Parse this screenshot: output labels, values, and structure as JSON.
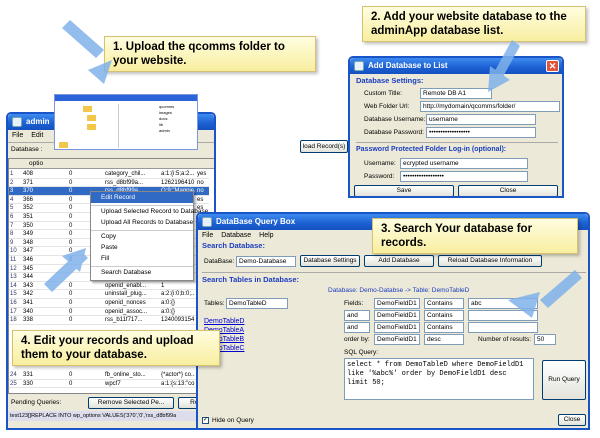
{
  "callouts": {
    "c1": "1. Upload the qcomms folder to your website.",
    "c2": "2. Add your website database to the adminApp database list.",
    "c3": "3. Search Your database for records.",
    "c4": "4. Edit your records and upload them to your database."
  },
  "admin": {
    "title": "admin",
    "menu": [
      "File",
      "Edit"
    ],
    "db_label": "Database :",
    "upload_btn": "load Record(s)",
    "col_header": "optio",
    "rows": [
      {
        "n": "1",
        "id": "408",
        "a": "0",
        "b": "category_chil...",
        "c": "a:1:{i:5;a:2...",
        "d": "yes"
      },
      {
        "n": "2",
        "id": "371",
        "a": "0",
        "b": "rss_d8bf99a...",
        "c": "1262196410",
        "d": "no"
      },
      {
        "n": "3",
        "id": "370",
        "a": "0",
        "b": "rss_d8bf99a...",
        "c": "O:9:\"Magpie...",
        "d": "no"
      },
      {
        "n": "4",
        "id": "366",
        "a": "0",
        "b": "",
        "c": "",
        "d": "es"
      },
      {
        "n": "5",
        "id": "352",
        "a": "0",
        "b": "",
        "c": "",
        "d": "es"
      },
      {
        "n": "6",
        "id": "351",
        "a": "0",
        "b": "",
        "c": "",
        "d": "es"
      },
      {
        "n": "7",
        "id": "350",
        "a": "0",
        "b": "",
        "c": "",
        "d": "es"
      },
      {
        "n": "8",
        "id": "349",
        "a": "0",
        "b": "",
        "c": "",
        "d": "es"
      },
      {
        "n": "9",
        "id": "348",
        "a": "0",
        "b": "",
        "c": "",
        "d": "es"
      },
      {
        "n": "10",
        "id": "347",
        "a": "0",
        "b": "",
        "c": "",
        "d": ""
      },
      {
        "n": "11",
        "id": "346",
        "a": "0",
        "b": "",
        "c": "",
        "d": ""
      },
      {
        "n": "12",
        "id": "345",
        "a": "",
        "b": "",
        "c": "",
        "d": ""
      },
      {
        "n": "13",
        "id": "344",
        "a": "",
        "b": "",
        "c": "",
        "d": ""
      },
      {
        "n": "14",
        "id": "343",
        "a": "0",
        "b": "openid_enabl...",
        "c": "1",
        "d": ""
      },
      {
        "n": "15",
        "id": "342",
        "a": "0",
        "b": "uninstall_plug...",
        "c": "a:2:{i:0;b:0;...",
        "d": ""
      },
      {
        "n": "16",
        "id": "341",
        "a": "0",
        "b": "openid_nonces",
        "c": "a:0:{}",
        "d": ""
      },
      {
        "n": "17",
        "id": "340",
        "a": "0",
        "b": "openid_assoc...",
        "c": "a:0:{}",
        "d": ""
      },
      {
        "n": "18",
        "id": "338",
        "a": "0",
        "b": "rss_b11f717...",
        "c": "1240093154",
        "d": ""
      }
    ],
    "rows_bottom": [
      {
        "n": "24",
        "id": "331",
        "a": "0",
        "b": "fb_online_sto...",
        "c": "{*actor*} co...",
        "d": ""
      },
      {
        "n": "25",
        "id": "330",
        "a": "0",
        "b": "wpcf7",
        "c": "a:1:{s:13:\"co...",
        "d": ""
      }
    ],
    "pending_label": "Pending Queries:",
    "remove_btn": "Remove Selected Pe...",
    "remove_btn2": "Rem",
    "status_sql": "test123[]REPLACE INTO wp_options  VALUES('370','0','rss_d8bf99a"
  },
  "context_menu": {
    "items": [
      "Edit Record",
      "Upload Selected Record to Database",
      "Upload All Records to Database",
      "Copy",
      "Paste",
      "Fill",
      "Search Database"
    ]
  },
  "explorer": {
    "folders": [
      "qcomms",
      "images",
      "docs",
      "lib",
      "admin"
    ]
  },
  "add_db": {
    "title": "Add Database to List",
    "section1": "Database Settings:",
    "custom_title_label": "Custom Title:",
    "custom_title": "Remote DB A1",
    "url_label": "Web Folder Url:",
    "url": "http://mydomain/qcomms/folder/",
    "user_label": "Database Username:",
    "user": "username",
    "pass_label": "Database Password:",
    "pass": "••••••••••••••••••",
    "section2": "Password Protected Folder Log-in (optional):",
    "login_user_label": "Username:",
    "login_user": "ecrypted username",
    "login_pass_label": "Password:",
    "login_pass": "••••••••••••••••••",
    "save": "Save",
    "close": "Close"
  },
  "query": {
    "title": "DataBase Query Box",
    "menu": [
      "File",
      "Database",
      "Help"
    ],
    "search_db_label": "Search Database:",
    "database_label": "DataBase:",
    "database_value": "Demo-Database",
    "db_settings_btn": "Database Settings",
    "add_db_btn": "Add Database",
    "reload_btn": "Reload Database Information",
    "search_tables_label": "Search Tables in Database:",
    "breadcrumb": "Database: Demo-Databse  ->  Table: DemoTableD",
    "tables_label": "Tables:",
    "tables_value": "DemoTableD",
    "tables": [
      "DemoTableD",
      "DemoTableA",
      "DemoTableB",
      "DemoTableC"
    ],
    "fields_label": "Fields:",
    "conditions": [
      {
        "join": "",
        "field": "DemoFieldD1",
        "op": "Contains",
        "value": "abc"
      },
      {
        "join": "and",
        "field": "DemoFieldD1",
        "op": "Contains",
        "value": ""
      },
      {
        "join": "and",
        "field": "DemoFieldD1",
        "op": "Contains",
        "value": ""
      }
    ],
    "orderby_label": "order by:",
    "orderby_field": "DemoFieldD1",
    "orderby_dir": "desc",
    "num_results_label": "Number of results:",
    "num_results": "50",
    "sql_label": "SQL Query:",
    "sql": "select * from DemoTableD where DemoFieldD1 like '%abc%' order by DemoFieldD1 desc limit 50;",
    "run_btn": "Run Query",
    "hide_label": "Hide on Query",
    "close_btn": "Close"
  },
  "colors": {
    "xp_blue": "#1a55c8",
    "callout_bg": "#fcf3b8",
    "link": "#0000cc",
    "selected_row": "#316ac5"
  }
}
